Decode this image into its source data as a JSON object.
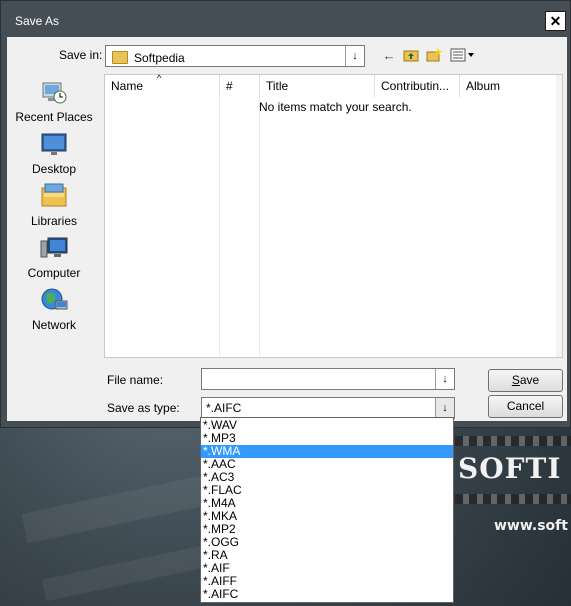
{
  "dialog": {
    "title": "Save As",
    "close_symbol": "✕"
  },
  "location": {
    "label": "Save in:",
    "value": "Softpedia"
  },
  "places": [
    {
      "label": "Recent Places",
      "icon": "recent-places-icon"
    },
    {
      "label": "Desktop",
      "icon": "desktop-icon"
    },
    {
      "label": "Libraries",
      "icon": "libraries-icon"
    },
    {
      "label": "Computer",
      "icon": "computer-icon"
    },
    {
      "label": "Network",
      "icon": "network-icon"
    }
  ],
  "columns": [
    "Name",
    "#",
    "Title",
    "Contributin...",
    "Album"
  ],
  "empty_message": "No items match your search.",
  "file_name": {
    "label": "File name:",
    "value": ""
  },
  "save_as_type": {
    "label": "Save as type:",
    "value": "*.AIFC",
    "options": [
      "*.WAV",
      "*.MP3",
      "*.WMA",
      "*.AAC",
      "*.AC3",
      "*.FLAC",
      "*.M4A",
      "*.MKA",
      "*.MP2",
      "*.OGG",
      "*.RA",
      "*.AIF",
      "*.AIFF",
      "*.AIFC"
    ],
    "highlighted": "*.WMA"
  },
  "buttons": {
    "save_rest": "ave",
    "save_mnemonic": "S",
    "cancel": "Cancel"
  },
  "background": {
    "brand": "SOFTI",
    "url": "www.soft"
  },
  "colors": {
    "selection": "#3399ff",
    "title_bar": "#454e55"
  }
}
